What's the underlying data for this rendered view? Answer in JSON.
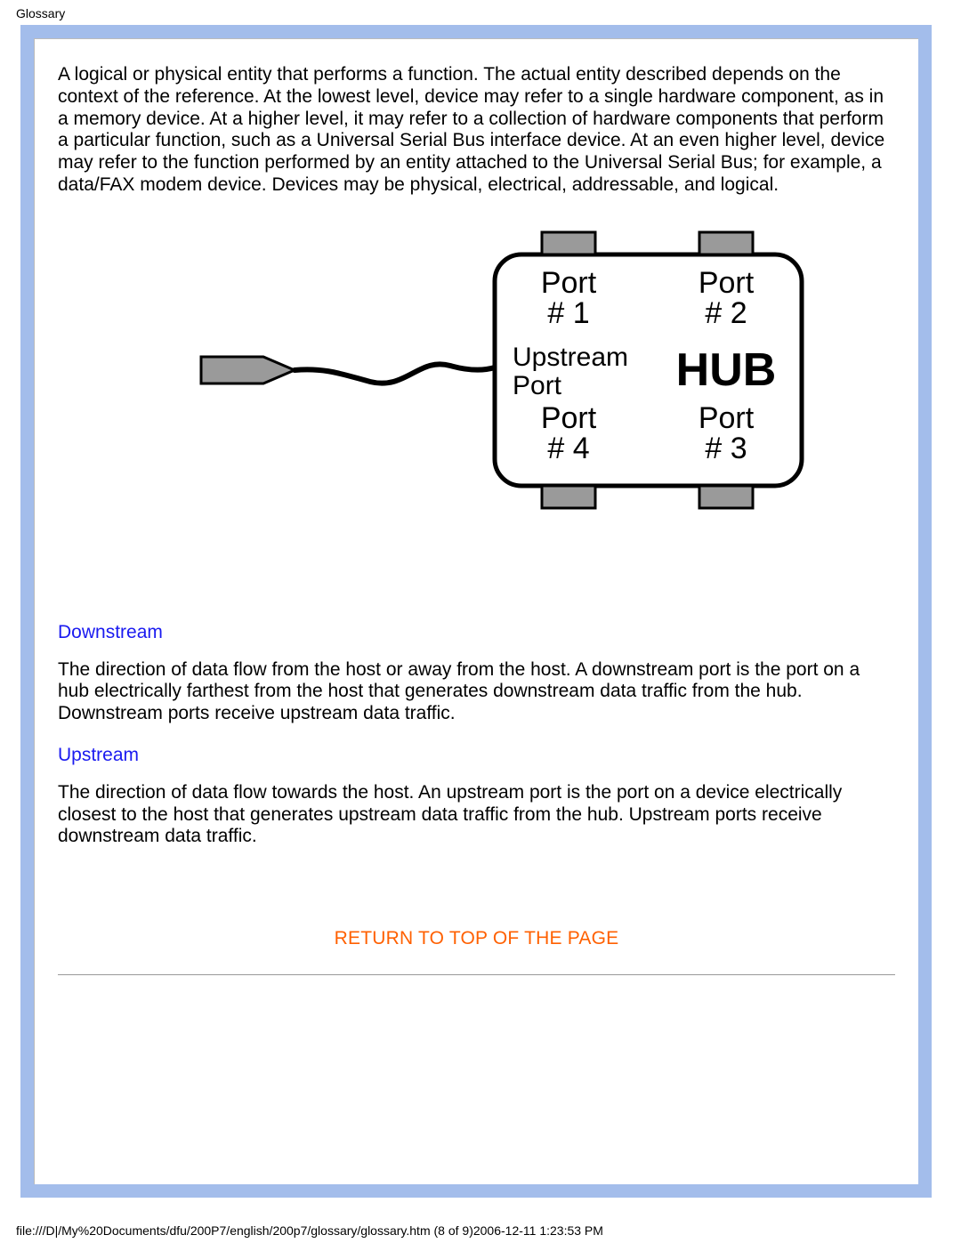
{
  "header": {
    "label": "Glossary"
  },
  "body": {
    "device_paragraph": "A logical or physical entity that performs a function. The actual entity described depends on the context of the reference. At the lowest level, device may refer to a single hardware component, as in a memory device. At a higher level, it may refer to a collection of hardware components that perform a particular function, such as a Universal Serial Bus interface device. At an even higher level, device may refer to the function performed by an entity attached to the Universal Serial Bus; for example, a data/FAX modem device. Devices may be physical, electrical, addressable, and logical.",
    "downstream": {
      "title": "Downstream",
      "text": "The direction of data flow from the host or away from the host. A downstream port is the port on a hub electrically farthest from the host that generates downstream data traffic from the hub. Downstream ports receive upstream data traffic."
    },
    "upstream": {
      "title": "Upstream",
      "text": "The direction of data flow towards the host. An upstream port is the port on a device electrically closest to the host that generates upstream data traffic from the hub. Upstream ports receive downstream data traffic."
    },
    "return_link": "RETURN TO TOP OF THE PAGE"
  },
  "diagram": {
    "labels": {
      "port1_line1": "Port",
      "port1_line2": "# 1",
      "port2_line1": "Port",
      "port2_line2": "# 2",
      "port3_line1": "Port",
      "port3_line2": "# 3",
      "port4_line1": "Port",
      "port4_line2": "# 4",
      "upstream_line1": "Upstream",
      "upstream_line2": "Port",
      "hub": "HUB"
    }
  },
  "footer": {
    "text": "file:///D|/My%20Documents/dfu/200P7/english/200p7/glossary/glossary.htm (8 of 9)2006-12-11 1:23:53 PM"
  }
}
